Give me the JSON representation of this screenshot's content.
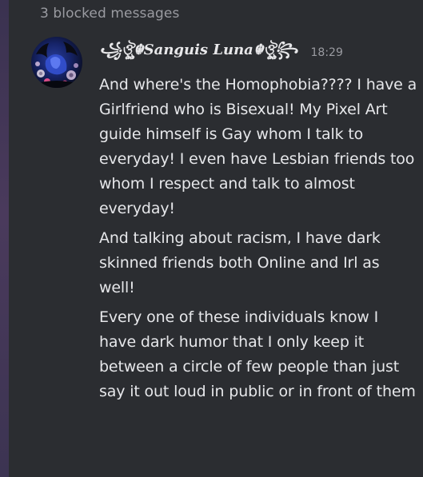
{
  "blocked_messages": "3 blocked messages",
  "message": {
    "author": "꧁ঔৣ☬Sanguis Luna☬ঔৣ꧂",
    "timestamp": "18:29",
    "paragraphs": [
      "And where's the Homophobia???? I have a Girlfriend who is Bisexual! My Pixel Art guide himself is Gay whom I talk to everyday! I even have Lesbian friends too whom I respect and talk to almost everyday!",
      "And talking about racism, I have dark skinned friends both Online and Irl as well!",
      "Every one of these individuals know I have dark humor that I only keep it between a circle of few people than just say it out loud in public or in front of them"
    ]
  },
  "colors": {
    "background": "#2b2d31",
    "text": "#e6e7ea",
    "muted": "#9a9ba1"
  }
}
